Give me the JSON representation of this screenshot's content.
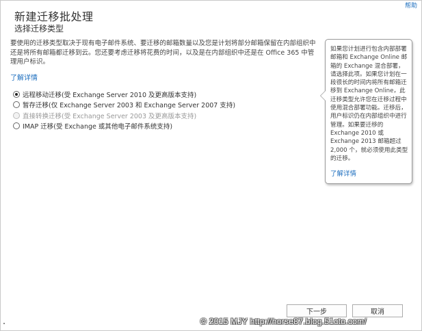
{
  "header": {
    "help": "帮助",
    "title": "新建迁移批处理",
    "subtitle": "选择迁移类型"
  },
  "intro": {
    "text": "要使用的迁移类型取决于现有电子邮件系统、要迁移的邮箱数量以及您是计划将部分邮箱保留在内部组织中还是将所有邮箱都迁移到云。您还要考虑迁移将花费的时间，以及是在内部组织中还是在 Office 365 中管理用户标识。",
    "learn_more": "了解详情"
  },
  "options": [
    {
      "label": "远程移动迁移(受 Exchange Server 2010 及更高版本支持)",
      "checked": true,
      "disabled": false
    },
    {
      "label": "暂存迁移(仅 Exchange Server 2003 和 Exchange Server 2007 支持)",
      "checked": false,
      "disabled": false
    },
    {
      "label": "直接转换迁移(受 Exchange Server 2003 及更高版本支持)",
      "checked": false,
      "disabled": true
    },
    {
      "label": "IMAP 迁移(受 Exchange 或其他电子邮件系统支持)",
      "checked": false,
      "disabled": false
    }
  ],
  "callout": {
    "text": "如果您计划进行包含内部部署邮箱和 Exchange Online 邮箱的 Exchange 混合部署，请选择此项。如果您计划在一段很长的时间内将所有邮箱迁移到 Exchange Online，此迁移类型允许您在迁移过程中使用混合部署功能。迁移后，用户标识仍在内部组织中进行管理。如果要迁移的 Exchange 2010 或 Exchange 2013 邮箱超过 2,000 个，就必须使用此类型的迁移。",
    "learn_more": "了解详情"
  },
  "buttons": {
    "next": "下一步",
    "cancel": "取消"
  },
  "watermark": "© 2015 MJY http://horse87.blog.51cto.com/"
}
